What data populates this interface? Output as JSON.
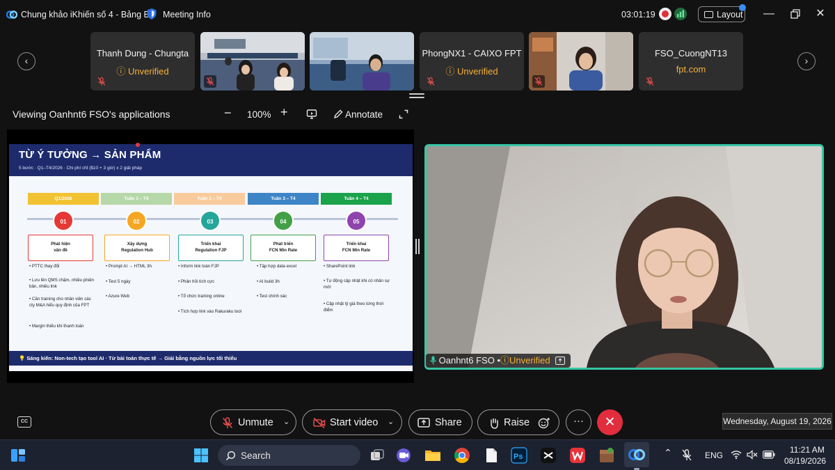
{
  "window": {
    "title": "Chung khảo iKhiến số 4 - Bảng B",
    "meeting_info": "Meeting Info",
    "timer": "03:01:19",
    "layout_label": "Layout"
  },
  "participants": [
    {
      "name": "Thanh Dung - Chungta",
      "status": "Unverified",
      "status_type": "warn",
      "video": false
    },
    {
      "name": "",
      "status": "",
      "video": true
    },
    {
      "name": "",
      "status": "",
      "video": true
    },
    {
      "name": "PhongNX1 - CAIXO FPT",
      "status": "Unverified",
      "status_type": "warn",
      "video": false
    },
    {
      "name": "",
      "status": "",
      "video": true
    },
    {
      "name": "FSO_CuongNT13",
      "status": "fpt.com",
      "status_type": "org",
      "video": false
    }
  ],
  "share": {
    "viewing_label": "Viewing Oanhnt6 FSO's applications",
    "zoom": "100%",
    "annotate_label": "Annotate"
  },
  "slide": {
    "title": "TỪ Ý TƯỞNG → SẢN PHẨM",
    "subtitle": "5 bước · Q1–T4/2026 · Chi phí chỉ ($10 + 3 giờ) x 2 giải pháp",
    "phases": [
      {
        "label": "Q1/2026",
        "color": "#f1c232"
      },
      {
        "label": "Tuần 1 – T4",
        "color": "#b6d7a8"
      },
      {
        "label": "Tuần 2 – T4",
        "color": "#f9cb9c"
      },
      {
        "label": "Tuần 3 – T4",
        "color": "#3d85c6"
      },
      {
        "label": "Tuần 4 – T4",
        "color": "#1aa34a"
      }
    ],
    "steps": [
      {
        "num": "01",
        "color": "#e53935",
        "title1": "Phát hiện",
        "title2": "vấn đề",
        "bullets": [
          "• PTTC thay đổi",
          "• Lưu lên QMS chậm, nhiều phiên bản, nhiều link",
          "• Cần training cho nhân viên các cty M&A hiểu quy định của FPT",
          "• Margin thiếu khi thanh toán"
        ]
      },
      {
        "num": "02",
        "color": "#f5a623",
        "title1": "Xây dựng",
        "title2": "Regulation Hub",
        "bullets": [
          "• Prompt AI → HTML 3h",
          "• Test 5 ngày",
          "• Azure Web"
        ]
      },
      {
        "num": "03",
        "color": "#26a69a",
        "title1": "Triển khai",
        "title2": "Regulation FJP",
        "bullets": [
          "• Inform link toàn FJP",
          "• Phản hồi tích cực",
          "• Tổ chức training online",
          "• Tích hợp link vào Rakuraku tool"
        ]
      },
      {
        "num": "04",
        "color": "#43a047",
        "title1": "Phát triển",
        "title2": "FCN Min Rate",
        "bullets": [
          "• Tập hợp data excel",
          "• AI build 3h",
          "• Test chính xác"
        ]
      },
      {
        "num": "05",
        "color": "#8e44ad",
        "title1": "Triển khai",
        "title2": "FCN Min Rate",
        "bullets": [
          "• SharePoint link",
          "• Tự động cập nhật khi có nhân sự mới",
          "• Cập nhật tỷ giá theo từng thời điểm"
        ]
      }
    ],
    "footer": "💡 Sáng kiến: Non-tech tạo tool AI · Từ bài toán thực tế → Giải bằng nguồn lực tối thiểu"
  },
  "speaker": {
    "name": "Oanhnt6 FSO",
    "separator": "•",
    "status": "Unverified"
  },
  "controls": {
    "cc_label": "CC",
    "unmute": "Unmute",
    "start_video": "Start video",
    "share": "Share",
    "raise": "Raise",
    "more": "···",
    "leave": "✕"
  },
  "date_tooltip": "Wednesday, August 19, 2026",
  "taskbar": {
    "search_label": "Search",
    "language": "ENG",
    "time": "11:21 AM",
    "date": "08/19/2026"
  },
  "colors": {
    "accent_teal": "#37c6a4",
    "warning": "#f5b036",
    "leave_red": "#e22d3f",
    "slide_header": "#1d2b6d"
  }
}
